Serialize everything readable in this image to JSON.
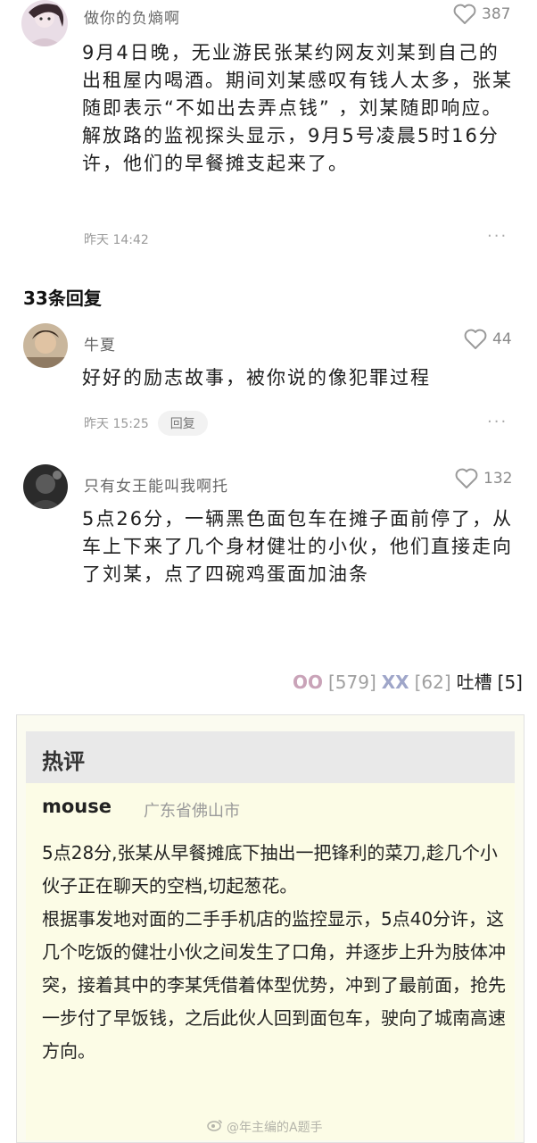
{
  "comments": [
    {
      "user": "做你的负熵啊",
      "likes": "387",
      "text": "9月4日晚，无业游民张某约网友刘某到自己的出租屋内喝酒。期间刘某感叹有钱人太多，张某随即表示“不如出去弄点钱” ，刘某随即响应。解放路的监视探头显示，9月5号凌晨5时16分许，他们的早餐摊支起来了。",
      "time": "昨天 14:42",
      "more": "···"
    },
    {
      "user": "牛夏",
      "likes": "44",
      "text": "好好的励志故事，被你说的像犯罪过程",
      "time": "昨天 15:25",
      "reply_label": "回复",
      "more": "···"
    },
    {
      "user": "只有女王能叫我啊托",
      "likes": "132",
      "text": "5点26分，一辆黑色面包车在摊子面前停了，从车上下来了几个身材健壮的小伙，他们直接走向了刘某，点了四碗鸡蛋面加油条"
    }
  ],
  "replies_header": "33条回复",
  "reactions": {
    "oo_label": "OO",
    "oo_count": "[579]",
    "xx_label": "XX",
    "xx_count": "[62]",
    "tucao_label": "吐槽",
    "tucao_count": "[5]"
  },
  "hot": {
    "title": "热评",
    "user": "mouse",
    "location": "广东省佛山市",
    "paragraphs": [
      "5点28分,张某从早餐摊底下抽出一把锋利的菜刀,趁几个小伙子正在聊天的空档,切起葱花。",
      "根据事发地对面的二手手机店的监控显示，5点40分许，这几个吃饭的健壮小伙之间发生了口角，并逐步上升为肢体冲突，接着其中的李某凭借着体型优势，冲到了最前面，抢先一步付了早饭钱，之后此伙人回到面包车，驶向了城南高速方向。"
    ]
  },
  "watermark": "@年主编的A题手",
  "icons": {
    "like": "heart-outline-icon",
    "weibo": "weibo-icon"
  },
  "colors": {
    "oo": "#c9a3b8",
    "xx": "#9fa6c9",
    "card_bg": "#fcfce6",
    "card_header_bg": "#e9e9e9"
  }
}
